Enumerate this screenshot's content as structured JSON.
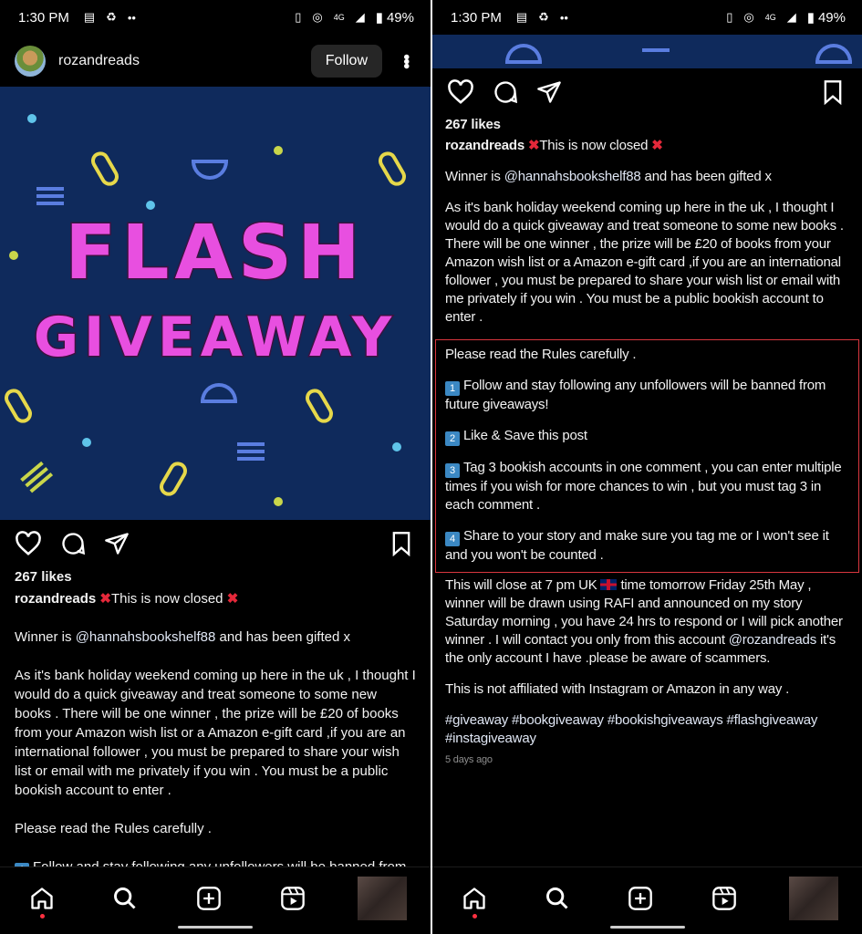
{
  "status": {
    "time": "1:30 PM",
    "network": "4G",
    "battery": "49%"
  },
  "header": {
    "username": "rozandreads",
    "follow_label": "Follow"
  },
  "image": {
    "line1": "FLASH",
    "line2": "GIVEAWAY",
    "bg_color": "#0f2a5c",
    "text_color": "#e84fe0"
  },
  "post": {
    "likes": "267 likes",
    "username": "rozandreads",
    "headline": "This is now closed",
    "winner_pre": "Winner is ",
    "winner_handle": "@hannahsbookshelf88",
    "winner_post": " and has been gifted x",
    "intro": "As it's bank holiday weekend coming up here in the uk , I thought I would do a quick giveaway and treat someone to some new books . There will be one winner , the prize will be £20 of books from your Amazon wish list or a Amazon e-gift card ,if you are an international follower , you must be prepared to share your wish list or email with me privately if you win . You must be a public bookish account to enter .",
    "rules_title": "Please read the Rules carefully .",
    "rules": [
      {
        "num": "1",
        "text": "Follow and stay following any unfollowers will be banned from future giveaways!"
      },
      {
        "num": "2",
        "text": "Like & Save this post"
      },
      {
        "num": "3",
        "text": "Tag 3 bookish accounts in one comment , you can enter multiple times if you wish for more chances to win , but you must tag 3 in each comment ."
      },
      {
        "num": "4",
        "text": "Share to your story and make sure you tag me or I won't see it and you won't be counted ."
      }
    ],
    "close_pre": "This will close at 7 pm UK ",
    "close_post": " time tomorrow Friday 25th May , winner will be drawn using RAFI and announced on my story Saturday morning , you have 24 hrs to respond or I will pick another winner . I will contact you only from this account ",
    "close_handle": "@rozandreads",
    "close_end": " it's the only account I have .please be aware of scammers.",
    "disclaimer": "This is not affiliated with Instagram or Amazon in any way .",
    "hashtags": "#giveaway #bookgiveaway #bookishgiveaways #flashgiveaway #instagiveaway",
    "time_ago": "5 days ago"
  },
  "colors": {
    "highlight_box": "#d9363e",
    "notification_dot": "#ff3040"
  }
}
